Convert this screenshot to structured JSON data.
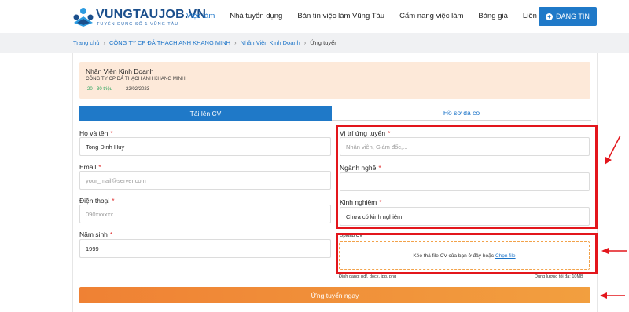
{
  "brand": {
    "name": "VUNGTAUJOB.VN",
    "tagline": "TUYỂN DỤNG SỐ 1 VŨNG TÀU",
    "accent": "#1f79c8",
    "logo_icon": "hands-network-logo-icon"
  },
  "nav": {
    "items": [
      {
        "label": "Việc làm",
        "active": true
      },
      {
        "label": "Nhà tuyển dụng",
        "active": false
      },
      {
        "label": "Bản tin việc làm Vũng Tàu",
        "active": false
      },
      {
        "label": "Cẩm nang việc làm",
        "active": false
      },
      {
        "label": "Bảng giá",
        "active": false
      },
      {
        "label": "Liên hệ",
        "active": false
      }
    ],
    "post_button": "ĐĂNG TIN"
  },
  "breadcrumb": {
    "items": [
      "Trang chủ",
      "CÔNG TY CP ĐÁ THẠCH ANH KHANG MINH",
      "Nhân Viên Kinh Doanh"
    ],
    "current": "Ứng tuyển"
  },
  "job": {
    "title": "Nhân Viên Kinh Doanh",
    "company": "CÔNG TY CP ĐÁ THẠCH ANH KHANG MINH",
    "salary": "20 - 30 triệu",
    "date": "22/02/2023",
    "salary_color": "#27a35a"
  },
  "tabs": {
    "upload": "Tải lên CV",
    "profile": "Hồ sơ đã có"
  },
  "form": {
    "name": {
      "label": "Họ và tên",
      "value": "Tong Dinh Huy"
    },
    "email": {
      "label": "Email",
      "placeholder": "your_mail@server.com"
    },
    "phone": {
      "label": "Điện thoại",
      "placeholder": "090xxxxxx"
    },
    "birth_year": {
      "label": "Năm sinh",
      "value": "1999"
    },
    "position": {
      "label": "Vị trí ứng tuyển",
      "placeholder": "Nhân viên, Giám đốc,..."
    },
    "industry": {
      "label": "Ngành nghề",
      "value": ""
    },
    "experience": {
      "label": "Kinh nghiệm",
      "value": "Chưa có kinh nghiệm"
    },
    "required_mark": "*"
  },
  "upload": {
    "label": "Upload CV",
    "drop_text": "Kéo thả file CV của bạn ở đây hoặc",
    "choose_link": "Chọn file",
    "formats": "Định dạng: pdf, docx, jpg, png",
    "max_size": "Dung lượng tối đa: 10MB"
  },
  "submit": "Ứng tuyển ngay",
  "highlight_color": "#e3161c"
}
